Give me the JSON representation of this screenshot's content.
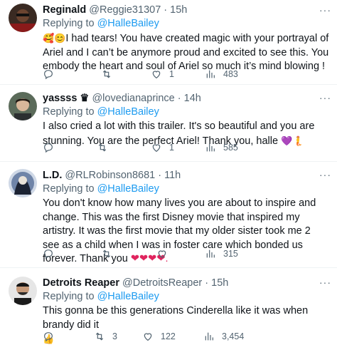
{
  "replying_prefix": "Replying to",
  "tweets": [
    {
      "name": "Reginald",
      "handle": "@Reggie31307",
      "sep": "·",
      "time": "15h",
      "mention": "@HalleBailey",
      "emoji_lead": "🥰😊",
      "text": "I had tears! You have created magic with your portrayal of Ariel and I can’t be anymore proud and excited to see this. You embody the heart and soul of Ariel so much it’s mind blowing !",
      "replies": "",
      "retweets": "",
      "likes": "1",
      "views": "483"
    },
    {
      "name": "yassss",
      "name_badge": "♛",
      "handle": "@lovedianaprince",
      "sep": "·",
      "time": "14h",
      "mention": "@HalleBailey",
      "text": "I also cried a lot with this trailer. It's so beautiful and you are stunning. You are the perfect Ariel! Thank you, halle",
      "emoji_tail": "💜🧜",
      "replies": "",
      "retweets": "",
      "likes": "1",
      "views": "585"
    },
    {
      "name": "L.D.",
      "handle": "@RLRobinson8681",
      "sep": "·",
      "time": "11h",
      "mention": "@HalleBailey",
      "text": "You don't know how many lives you are about to inspire and change. This was the first Disney movie that inspired my artistry. It was the first movie that my older sister took me 2 see as a child when I was in foster care which bonded us forever. Thank you",
      "emoji_tail": "❤❤❤❤.",
      "replies": "",
      "retweets": "",
      "likes": "",
      "views": "315"
    },
    {
      "name": "Detroits Reaper",
      "handle": "@DetroitsReaper",
      "sep": "·",
      "time": "15h",
      "mention": "@HalleBailey",
      "text": "This gonna be this generations Cinderella like it was when brandy did it",
      "emoji_tail": "👍",
      "replies": "",
      "retweets": "3",
      "likes": "122",
      "views": "3,454"
    }
  ],
  "more_label": "···"
}
